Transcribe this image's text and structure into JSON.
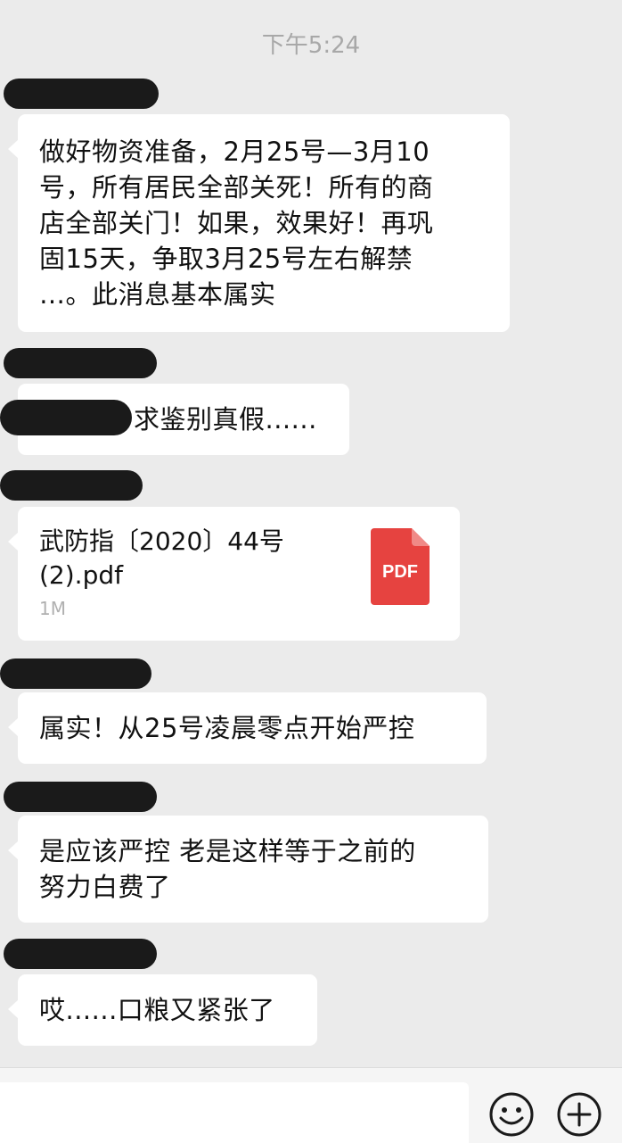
{
  "chat": {
    "timestamp": "下午5:24",
    "messages": [
      {
        "type": "text",
        "text": "做好物资准备，2月25号—3月10\n号，所有居民全部关死！所有的商\n店全部关门！如果，效果好！再巩\n固15天，争取3月25号左右解禁\n…。此消息基本属实"
      },
      {
        "type": "text",
        "text": "求鉴别真假......"
      },
      {
        "type": "file",
        "file_name": "武防指〔2020〕44号\n(2).pdf",
        "file_size": "1M",
        "icon_label": "PDF",
        "icon_color": "#e64340"
      },
      {
        "type": "text",
        "text": "属实！从25号凌晨零点开始严控"
      },
      {
        "type": "text",
        "text": "是应该严控 老是这样等于之前的\n努力白费了"
      },
      {
        "type": "text",
        "text": "哎......口粮又紧张了"
      }
    ]
  },
  "input_bar": {
    "emoji_icon": "smiley-face-icon",
    "more_icon": "plus-circle-icon"
  }
}
